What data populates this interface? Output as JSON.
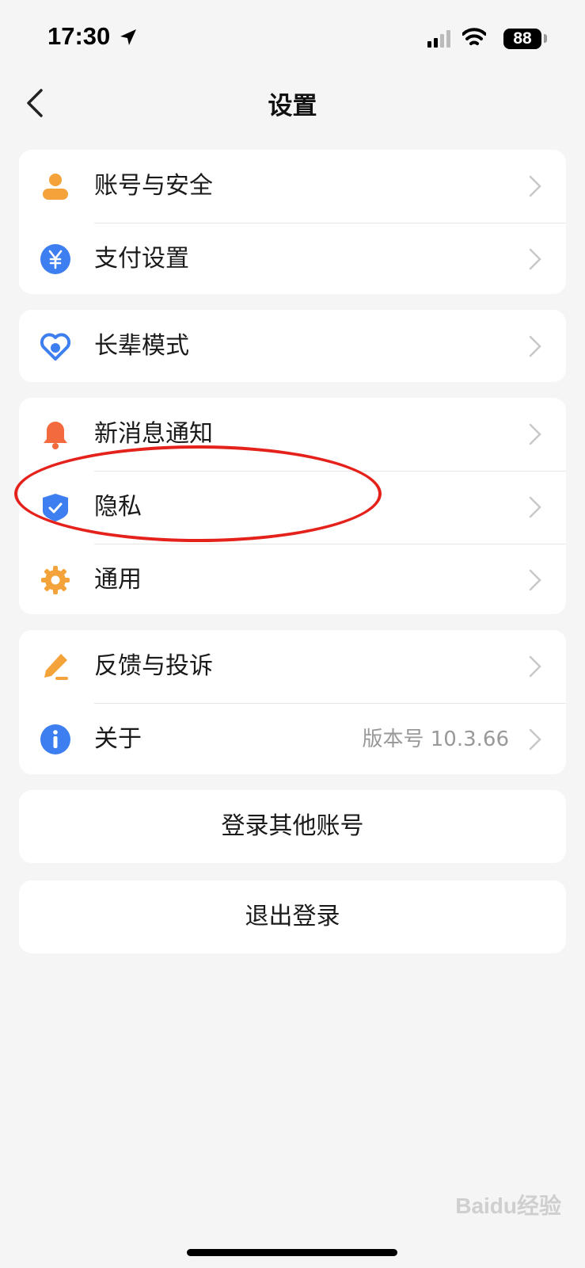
{
  "status_bar": {
    "time": "17:30",
    "battery": "88"
  },
  "nav": {
    "title": "设置"
  },
  "groups": [
    {
      "items": [
        {
          "label": "账号与安全",
          "icon": "user-icon"
        },
        {
          "label": "支付设置",
          "icon": "yuan-icon"
        }
      ]
    },
    {
      "items": [
        {
          "label": "长辈模式",
          "icon": "heart-icon"
        }
      ]
    },
    {
      "items": [
        {
          "label": "新消息通知",
          "icon": "bell-icon"
        },
        {
          "label": "隐私",
          "icon": "shield-check-icon"
        },
        {
          "label": "通用",
          "icon": "gear-icon"
        }
      ]
    },
    {
      "items": [
        {
          "label": "反馈与投诉",
          "icon": "pencil-icon"
        },
        {
          "label": "关于",
          "icon": "info-icon",
          "value": "版本号 10.3.66"
        }
      ]
    }
  ],
  "buttons": {
    "switch_account": "登录其他账号",
    "logout": "退出登录"
  },
  "watermark": "Baidu经验",
  "colors": {
    "orange": "#f3a33a",
    "blue": "#3d7ef0",
    "bell": "#f26a3d",
    "annotation": "#e4221b"
  }
}
